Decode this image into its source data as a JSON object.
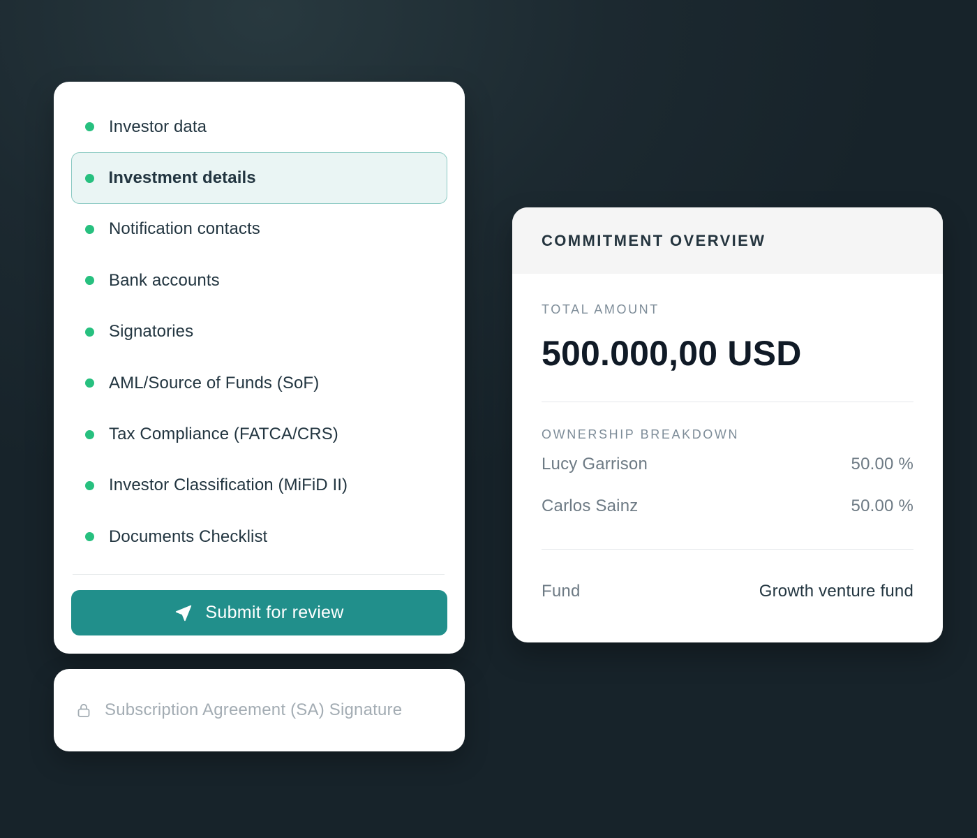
{
  "steps": {
    "items": [
      {
        "label": "Investor data",
        "active": false
      },
      {
        "label": "Investment details",
        "active": true
      },
      {
        "label": "Notification contacts",
        "active": false
      },
      {
        "label": "Bank accounts",
        "active": false
      },
      {
        "label": "Signatories",
        "active": false
      },
      {
        "label": "AML/Source of Funds (SoF)",
        "active": false
      },
      {
        "label": "Tax Compliance (FATCA/CRS)",
        "active": false
      },
      {
        "label": "Investor Classification (MiFiD II)",
        "active": false
      },
      {
        "label": "Documents Checklist",
        "active": false
      }
    ],
    "submit_label": "Submit for review",
    "submit_icon": "send-icon",
    "status_color": "#27c07f",
    "accent_color": "#218f8b"
  },
  "locked_step": {
    "label": "Subscription Agreement (SA) Signature",
    "icon": "lock-icon"
  },
  "commitment": {
    "title": "COMMITMENT OVERVIEW",
    "total_label": "TOTAL AMOUNT",
    "total_amount": "500.000,00 USD",
    "ownership_label": "OWNERSHIP BREAKDOWN",
    "owners": [
      {
        "name": "Lucy Garrison",
        "share": "50.00 %"
      },
      {
        "name": "Carlos Sainz",
        "share": "50.00 %"
      }
    ],
    "fund_label": "Fund",
    "fund_value": "Growth venture fund"
  }
}
